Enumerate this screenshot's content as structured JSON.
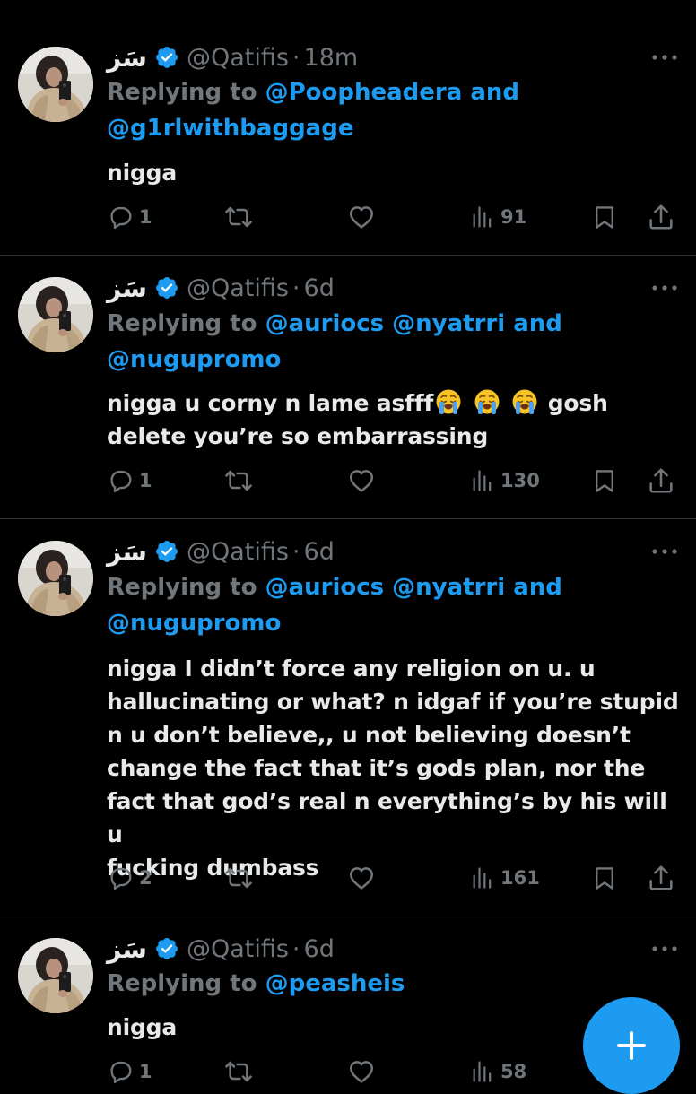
{
  "colors": {
    "background": "#000000",
    "text": "#e7e9ea",
    "muted": "#71767b",
    "accent": "#1d9bf0",
    "divider": "#2f3336"
  },
  "tweets": [
    {
      "display_name": "سَز",
      "handle": "@Qatifis",
      "separator": "·",
      "time": "18m",
      "replying_label": "Replying to",
      "mentions_line1": "@Poopheadera",
      "mentions_and": "and",
      "mentions_line2": "@g1rlwithbaggage",
      "text": "nigga",
      "replies": "1",
      "views": "91"
    },
    {
      "display_name": "سَز",
      "handle": "@Qatifis",
      "separator": "·",
      "time": "6d",
      "replying_label": "Replying to",
      "mentions_line1": "@auriocs @nyatrri",
      "mentions_and": "and",
      "mentions_line2": "@nugupromo",
      "text_part1": "nigga u corny n lame asfff",
      "text_part2": "gosh",
      "text_line2": "delete you’re so embarrassing",
      "emoji": [
        "loudly-crying-face",
        "loudly-crying-face",
        "loudly-crying-face"
      ],
      "replies": "1",
      "views": "130"
    },
    {
      "display_name": "سَز",
      "handle": "@Qatifis",
      "separator": "·",
      "time": "6d",
      "replying_label": "Replying to",
      "mentions_line1": "@auriocs @nyatrri",
      "mentions_and": "and",
      "mentions_line2": "@nugupromo",
      "text_lines": [
        "nigga I didn’t force any religion on u. u",
        "hallucinating or what? n idgaf if you’re stupid",
        "n u don’t believe,, u not believing doesn’t",
        "change the fact that it’s gods plan, nor the",
        "fact that god’s real n everything’s by his will u",
        "fucking dumbass"
      ],
      "replies": "2",
      "views": "161"
    },
    {
      "display_name": "سَز",
      "handle": "@Qatifis",
      "separator": "·",
      "time": "6d",
      "replying_label": "Replying to",
      "mentions_line1": "@peasheis",
      "text": "nigga",
      "replies": "1",
      "views": "58"
    }
  ],
  "fab": {
    "icon": "plus-icon",
    "action": "compose"
  }
}
